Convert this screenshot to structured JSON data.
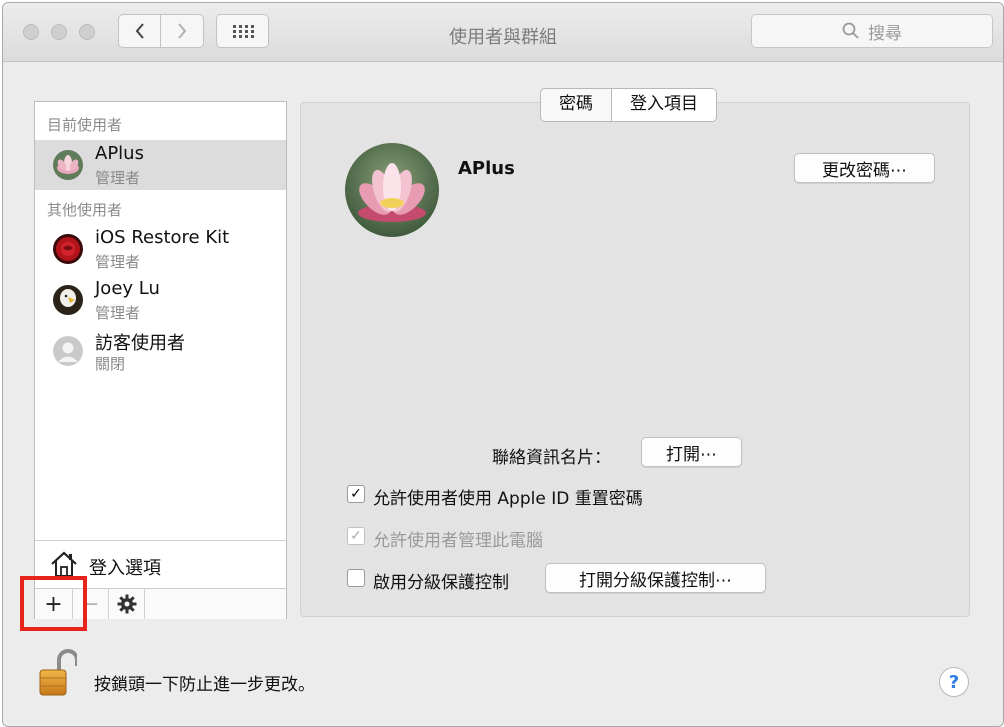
{
  "window": {
    "title": "使用者與群組"
  },
  "search": {
    "placeholder": "搜尋"
  },
  "sidebar": {
    "current_header": "目前使用者",
    "others_header": "其他使用者",
    "users": [
      {
        "name": "APlus",
        "role": "管理者",
        "selected": true
      },
      {
        "name": "iOS Restore Kit",
        "role": "管理者"
      },
      {
        "name": "Joey Lu",
        "role": "管理者"
      },
      {
        "name": "訪客使用者",
        "role": "關閉"
      }
    ],
    "login_options": "登入選項",
    "add_symbol": "+",
    "remove_symbol": "−"
  },
  "tabs": [
    {
      "label": "密碼",
      "active": false
    },
    {
      "label": "登入項目",
      "active": true
    }
  ],
  "user_panel": {
    "name": "APlus",
    "change_password_button": "更改密碼⋯",
    "contact_card_label": "聯絡資訊名片：",
    "open_button": "打開⋯",
    "allow_reset_apple_id": {
      "label": "允許使用者使用 Apple ID 重置密碼",
      "checked": true,
      "enabled": true
    },
    "allow_admin": {
      "label": "允許使用者管理此電腦",
      "checked": true,
      "enabled": false
    },
    "parental_controls": {
      "label": "啟用分級保護控制",
      "checked": false,
      "enabled": true
    },
    "open_parental_controls_button": "打開分級保護控制⋯"
  },
  "footer": {
    "lock_text": "按鎖頭一下防止進一步更改。",
    "help_symbol": "?"
  },
  "colors": {
    "highlight_box": "#e8231c",
    "accent": "#2e7de9"
  }
}
